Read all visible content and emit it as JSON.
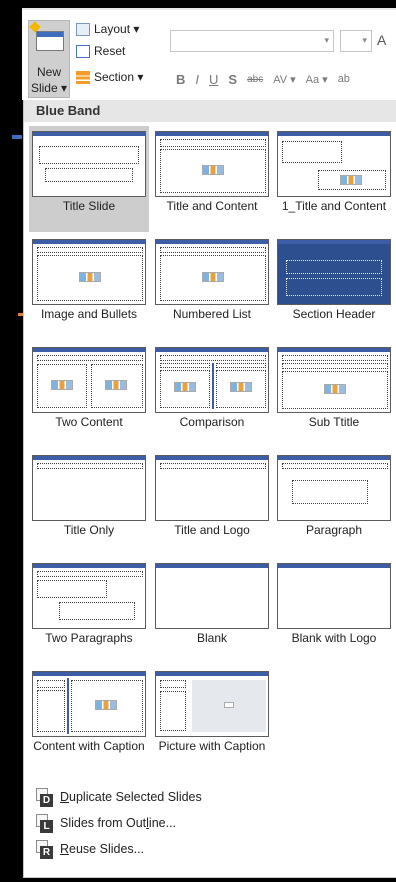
{
  "ribbon": {
    "new_slide_line1": "New",
    "new_slide_line2": "Slide ▾",
    "layout_label": "Layout ▾",
    "reset_label": "Reset",
    "section_label": "Section ▾",
    "font_size_sample": "A",
    "format_buttons": [
      "B",
      "I",
      "U",
      "S",
      "abc",
      "AV ▾",
      "Aa ▾",
      "ab"
    ]
  },
  "panel": {
    "title": "Blue Band",
    "layouts": [
      {
        "label": "Title Slide",
        "selected": true,
        "kind": "title-slide"
      },
      {
        "label": "Title and Content",
        "kind": "title-content"
      },
      {
        "label": "1_Title and Content",
        "kind": "title-content-2"
      },
      {
        "label": "Image and Bullets",
        "kind": "image-bullets"
      },
      {
        "label": "Numbered List",
        "kind": "numbered-list"
      },
      {
        "label": "Section Header",
        "kind": "section-header"
      },
      {
        "label": "Two Content",
        "kind": "two-content"
      },
      {
        "label": "Comparison",
        "kind": "comparison"
      },
      {
        "label": "Sub Ttitle",
        "kind": "sub-title"
      },
      {
        "label": "Title Only",
        "kind": "title-only"
      },
      {
        "label": "Title and Logo",
        "kind": "title-logo"
      },
      {
        "label": "Paragraph",
        "kind": "paragraph"
      },
      {
        "label": "Two Paragraphs",
        "kind": "two-paragraphs"
      },
      {
        "label": "Blank",
        "kind": "blank"
      },
      {
        "label": "Blank with Logo",
        "kind": "blank-logo"
      },
      {
        "label": "Content with Caption",
        "kind": "content-caption"
      },
      {
        "label": "Picture with Caption",
        "kind": "picture-caption"
      }
    ],
    "commands": [
      {
        "key": "D",
        "pre": "",
        "ul": "D",
        "post": "uplicate Selected Slides"
      },
      {
        "key": "L",
        "pre": "Slides from Out",
        "ul": "l",
        "post": "ine..."
      },
      {
        "key": "R",
        "pre": "",
        "ul": "R",
        "post": "euse Slides..."
      }
    ]
  },
  "colors": {
    "accent_blue": "#3d5ea6",
    "section_header_fill": "#2d4e8f",
    "selected_tile": "#cdcdcd",
    "panel_header": "#e6e6e6"
  }
}
